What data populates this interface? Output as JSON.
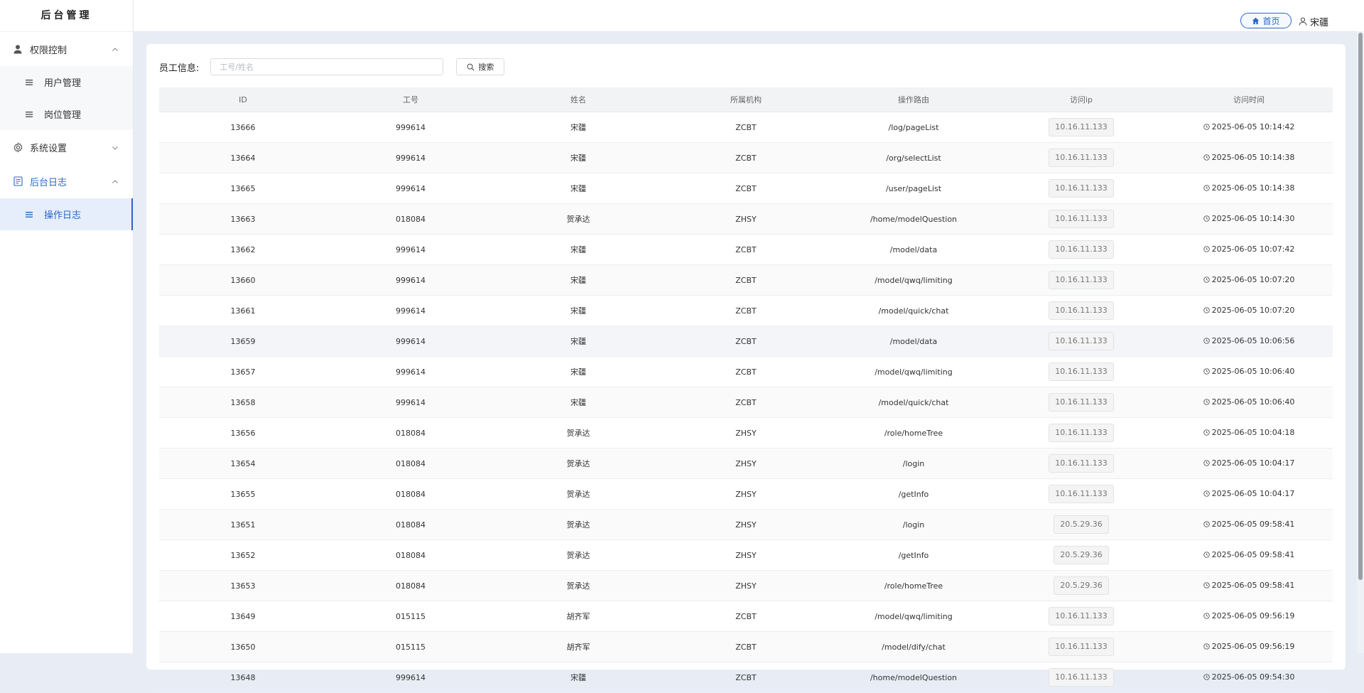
{
  "app": {
    "title": "后台管理"
  },
  "sidebar": {
    "groups": [
      {
        "label": "权限控制",
        "icon": "user-icon",
        "expanded": true,
        "items": [
          {
            "label": "用户管理"
          },
          {
            "label": "岗位管理"
          }
        ]
      },
      {
        "label": "系统设置",
        "icon": "gear-icon",
        "expanded": false,
        "items": []
      },
      {
        "label": "后台日志",
        "icon": "document-icon",
        "expanded": true,
        "items": [
          {
            "label": "操作日志",
            "active": true
          }
        ]
      }
    ],
    "accent_color": "#2c66c8"
  },
  "header": {
    "home_label": "首页",
    "user_name": "宋疆"
  },
  "filter": {
    "label": "员工信息:",
    "placeholder": "工号/姓名",
    "value": "",
    "search_label": "搜索"
  },
  "table": {
    "columns": [
      "ID",
      "工号",
      "姓名",
      "所属机构",
      "操作路由",
      "访问ip",
      "访问时间"
    ],
    "rows": [
      [
        "13666",
        "999614",
        "宋疆",
        "ZCBT",
        "/log/pageList",
        "10.16.11.133",
        "2025-06-05 10:14:42"
      ],
      [
        "13664",
        "999614",
        "宋疆",
        "ZCBT",
        "/org/selectList",
        "10.16.11.133",
        "2025-06-05 10:14:38"
      ],
      [
        "13665",
        "999614",
        "宋疆",
        "ZCBT",
        "/user/pageList",
        "10.16.11.133",
        "2025-06-05 10:14:38"
      ],
      [
        "13663",
        "018084",
        "贺承达",
        "ZHSY",
        "/home/modelQuestion",
        "10.16.11.133",
        "2025-06-05 10:14:30"
      ],
      [
        "13662",
        "999614",
        "宋疆",
        "ZCBT",
        "/model/data",
        "10.16.11.133",
        "2025-06-05 10:07:42"
      ],
      [
        "13660",
        "999614",
        "宋疆",
        "ZCBT",
        "/model/qwq/limiting",
        "10.16.11.133",
        "2025-06-05 10:07:20"
      ],
      [
        "13661",
        "999614",
        "宋疆",
        "ZCBT",
        "/model/quick/chat",
        "10.16.11.133",
        "2025-06-05 10:07:20"
      ],
      [
        "13659",
        "999614",
        "宋疆",
        "ZCBT",
        "/model/data",
        "10.16.11.133",
        "2025-06-05 10:06:56"
      ],
      [
        "13657",
        "999614",
        "宋疆",
        "ZCBT",
        "/model/qwq/limiting",
        "10.16.11.133",
        "2025-06-05 10:06:40"
      ],
      [
        "13658",
        "999614",
        "宋疆",
        "ZCBT",
        "/model/quick/chat",
        "10.16.11.133",
        "2025-06-05 10:06:40"
      ],
      [
        "13656",
        "018084",
        "贺承达",
        "ZHSY",
        "/role/homeTree",
        "10.16.11.133",
        "2025-06-05 10:04:18"
      ],
      [
        "13654",
        "018084",
        "贺承达",
        "ZHSY",
        "/login",
        "10.16.11.133",
        "2025-06-05 10:04:17"
      ],
      [
        "13655",
        "018084",
        "贺承达",
        "ZHSY",
        "/getInfo",
        "10.16.11.133",
        "2025-06-05 10:04:17"
      ],
      [
        "13651",
        "018084",
        "贺承达",
        "ZHSY",
        "/login",
        "20.5.29.36",
        "2025-06-05 09:58:41"
      ],
      [
        "13652",
        "018084",
        "贺承达",
        "ZHSY",
        "/getInfo",
        "20.5.29.36",
        "2025-06-05 09:58:41"
      ],
      [
        "13653",
        "018084",
        "贺承达",
        "ZHSY",
        "/role/homeTree",
        "20.5.29.36",
        "2025-06-05 09:58:41"
      ],
      [
        "13649",
        "015115",
        "胡齐军",
        "ZCBT",
        "/model/qwq/limiting",
        "10.16.11.133",
        "2025-06-05 09:56:19"
      ],
      [
        "13650",
        "015115",
        "胡齐军",
        "ZCBT",
        "/model/dify/chat",
        "10.16.11.133",
        "2025-06-05 09:56:19"
      ],
      [
        "13648",
        "999614",
        "宋疆",
        "ZCBT",
        "/home/modelQuestion",
        "10.16.11.133",
        "2025-06-05 09:54:30"
      ]
    ]
  }
}
